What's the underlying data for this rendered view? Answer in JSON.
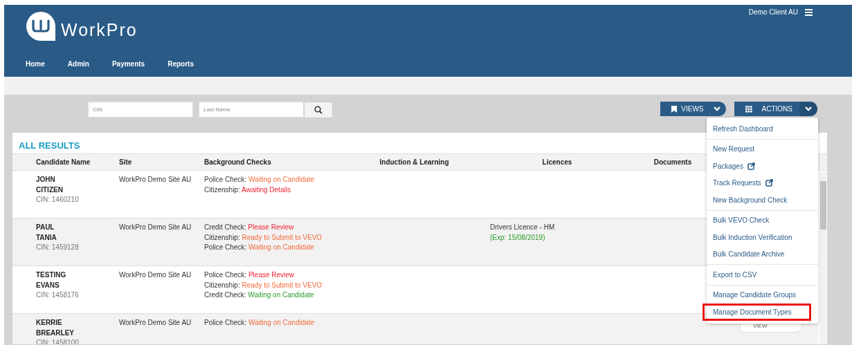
{
  "header": {
    "brand": "WorkPro",
    "client": "Demo Client AU",
    "nav": [
      "Home",
      "Admin",
      "Payments",
      "Reports"
    ]
  },
  "search": {
    "fields": [
      {
        "placeholder": "CIN"
      },
      {
        "placeholder": "Last Name"
      }
    ]
  },
  "toolbar": {
    "views": "VIEWS",
    "actions": "ACTIONS"
  },
  "actions_menu": {
    "groups": [
      [
        {
          "label": "Refresh Dashboard",
          "external": false,
          "highlighted": false
        }
      ],
      [
        {
          "label": "New Request",
          "external": false,
          "highlighted": false
        },
        {
          "label": "Packages",
          "external": true,
          "highlighted": false
        },
        {
          "label": "Track Requests",
          "external": true,
          "highlighted": false
        },
        {
          "label": "New Background Check",
          "external": false,
          "highlighted": false
        }
      ],
      [
        {
          "label": "Bulk VEVO Check",
          "external": false,
          "highlighted": false
        },
        {
          "label": "Bulk Induction Verification",
          "external": false,
          "highlighted": false
        },
        {
          "label": "Bulk Candidate Archive",
          "external": false,
          "highlighted": false
        }
      ],
      [
        {
          "label": "Export to CSV",
          "external": false,
          "highlighted": false
        }
      ],
      [
        {
          "label": "Manage Candidate Groups",
          "external": false,
          "highlighted": false
        },
        {
          "label": "Manage Document Types",
          "external": false,
          "highlighted": true
        }
      ]
    ]
  },
  "results": {
    "title": "ALL RESULTS",
    "columns": [
      "Candidate Name",
      "Site",
      "Background Checks",
      "Induction & Learning",
      "Licences",
      "Documents"
    ],
    "rows": [
      {
        "first": "JOHN",
        "last": "CITIZEN",
        "cin": "CIN: 1460210",
        "site": "WorkPro Demo Site AU",
        "checks": [
          {
            "label": "Police Check:",
            "status": "Waiting on Candidate",
            "color": "#f26b3a"
          },
          {
            "label": "Citizenship:",
            "status": "Awaiting Details",
            "color": "#ee2233"
          }
        ],
        "licences": []
      },
      {
        "first": "PAUL",
        "last": "TANIA",
        "cin": "CIN: 1459128",
        "site": "WorkPro Demo Site AU",
        "checks": [
          {
            "label": "Credit Check:",
            "status": "Please Review",
            "color": "#ee2233"
          },
          {
            "label": "Citizenship:",
            "status": "Ready to Submit to VEVO",
            "color": "#f26b3a"
          },
          {
            "label": "Police Check:",
            "status": "Waiting on Candidate",
            "color": "#f26b3a"
          }
        ],
        "licences": [
          {
            "name": "Drivers Licence - HM",
            "expiry": "(Exp: 15/08/2019)"
          }
        ]
      },
      {
        "first": "TESTING",
        "last": "EVANS",
        "cin": "CIN: 1458176",
        "site": "WorkPro Demo Site AU",
        "checks": [
          {
            "label": "Police Check:",
            "status": "Please Review",
            "color": "#ee2233"
          },
          {
            "label": "Citizenship:",
            "status": "Ready to Submit to VEVO",
            "color": "#f26b3a"
          },
          {
            "label": "Credit Check:",
            "status": "Waiting on Candidate",
            "color": "#2a9a2a"
          }
        ],
        "licences": []
      },
      {
        "first": "KERRIE",
        "last": "BREARLEY",
        "cin": "CIN: 1458100",
        "site": "WorkPro Demo Site AU",
        "checks": [
          {
            "label": "Police Check:",
            "status": "Waiting on Candidate",
            "color": "#f26b3a"
          }
        ],
        "licences": [],
        "action": "VIEW"
      }
    ]
  }
}
